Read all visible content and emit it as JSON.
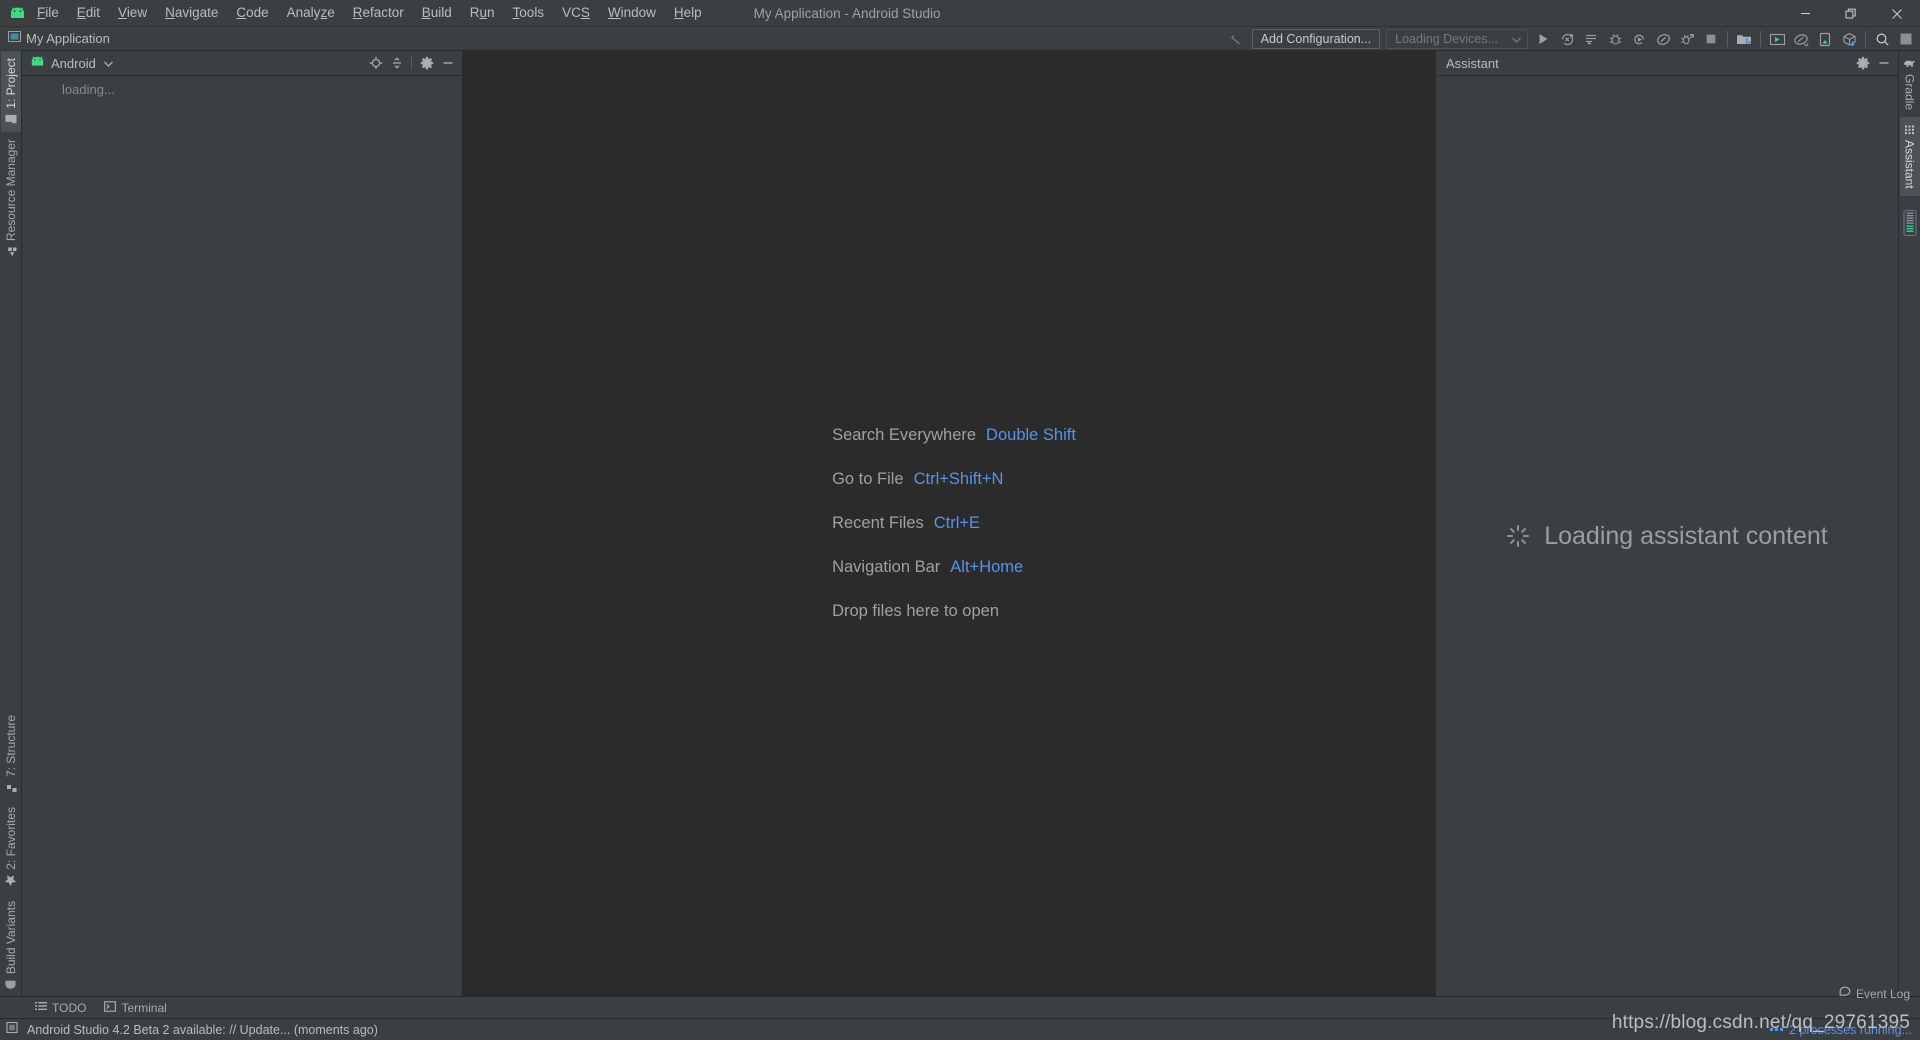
{
  "window": {
    "title": "My Application - Android Studio",
    "minimize_label": "Minimize",
    "restore_label": "Restore",
    "close_label": "Close"
  },
  "menubar": {
    "items": [
      {
        "label": "File",
        "mnemonic": "F"
      },
      {
        "label": "Edit",
        "mnemonic": "E"
      },
      {
        "label": "View",
        "mnemonic": "V"
      },
      {
        "label": "Navigate",
        "mnemonic": "N"
      },
      {
        "label": "Code",
        "mnemonic": "C"
      },
      {
        "label": "Analyze",
        "mnemonic": "z"
      },
      {
        "label": "Refactor",
        "mnemonic": "R"
      },
      {
        "label": "Build",
        "mnemonic": "B"
      },
      {
        "label": "Run",
        "mnemonic": "u"
      },
      {
        "label": "Tools",
        "mnemonic": "T"
      },
      {
        "label": "VCS",
        "mnemonic": "S"
      },
      {
        "label": "Window",
        "mnemonic": "W"
      },
      {
        "label": "Help",
        "mnemonic": "H"
      }
    ]
  },
  "navbar": {
    "breadcrumb": "My Application",
    "breadcrumb_icon": "module-icon",
    "back_icon": "back-arrow-icon",
    "add_configuration_label": "Add Configuration...",
    "device_selector_value": "Loading Devices...",
    "toolbar_icons": [
      {
        "name": "run-icon",
        "title": "Run"
      },
      {
        "name": "apply-changes-icon",
        "title": "Apply Changes"
      },
      {
        "name": "apply-code-changes-icon",
        "title": "Apply Code Changes"
      },
      {
        "name": "debug-icon",
        "title": "Debug"
      },
      {
        "name": "run-with-coverage-icon",
        "title": "Run with Coverage"
      },
      {
        "name": "profiler-icon",
        "title": "Profile"
      },
      {
        "name": "attach-debugger-icon",
        "title": "Attach Debugger to Process"
      },
      {
        "name": "stop-icon",
        "title": "Stop"
      },
      {
        "name": "sdk-manager-icon",
        "title": "SDK Manager"
      },
      {
        "name": "avd-manager-icon",
        "title": "AVD Manager"
      },
      {
        "name": "gradle-sync-icon",
        "title": "Sync Project with Gradle Files"
      },
      {
        "name": "device-file-explorer-icon",
        "title": "Device File Explorer"
      },
      {
        "name": "layout-inspector-icon",
        "title": "Layout Inspector"
      },
      {
        "name": "search-everywhere-icon",
        "title": "Search Everywhere"
      },
      {
        "name": "project-structure-icon",
        "title": "Project Structure"
      }
    ]
  },
  "left_strip": {
    "top_tabs": [
      {
        "label": "1: Project",
        "mnemonic": "1",
        "icon": "folder-icon",
        "active": true
      },
      {
        "label": "Resource Manager",
        "icon": "resource-manager-icon",
        "active": false
      }
    ],
    "bottom_tabs": [
      {
        "label": "7: Structure",
        "mnemonic": "7",
        "icon": "structure-icon",
        "active": false
      },
      {
        "label": "2: Favorites",
        "mnemonic": "2",
        "icon": "star-icon",
        "active": false
      },
      {
        "label": "Build Variants",
        "icon": "android-icon",
        "active": false
      }
    ]
  },
  "project_panel": {
    "icon": "android-head-icon",
    "view_label": "Android",
    "dropdown_icon": "chevron-down-icon",
    "actions": [
      {
        "name": "scroll-from-source-icon",
        "title": "Select Opened File"
      },
      {
        "name": "collapse-all-icon",
        "title": "Collapse All"
      },
      {
        "name": "settings-gear-icon",
        "title": "Options"
      },
      {
        "name": "hide-panel-icon",
        "title": "Hide"
      }
    ],
    "content_text": "loading..."
  },
  "editor": {
    "hints": [
      {
        "label": "Search Everywhere",
        "shortcut": "Double Shift"
      },
      {
        "label": "Go to File",
        "shortcut": "Ctrl+Shift+N"
      },
      {
        "label": "Recent Files",
        "shortcut": "Ctrl+E"
      },
      {
        "label": "Navigation Bar",
        "shortcut": "Alt+Home"
      },
      {
        "label": "Drop files here to open",
        "shortcut": ""
      }
    ]
  },
  "assistant_panel": {
    "title": "Assistant",
    "actions": [
      {
        "name": "settings-gear-icon",
        "title": "Settings"
      },
      {
        "name": "hide-panel-icon",
        "title": "Hide"
      }
    ],
    "loading_text": "Loading assistant content",
    "loading_icon": "spinner-icon"
  },
  "right_strip": {
    "tabs": [
      {
        "label": "Gradle",
        "icon": "gradle-elephant-icon",
        "active": false
      },
      {
        "label": "Assistant",
        "icon": "assistant-grid-icon",
        "active": true
      },
      {
        "label": "",
        "icon": "emulator-icon",
        "active": false
      }
    ]
  },
  "bottom_strip": {
    "tabs": [
      {
        "label": "TODO",
        "icon": "todo-list-icon"
      },
      {
        "label": "Terminal",
        "icon": "terminal-icon"
      }
    ]
  },
  "statusbar": {
    "icon": "notification-icon",
    "message": "Android Studio 4.2 Beta 2 available: // Update... (moments ago)",
    "event_log_label": "Event Log",
    "event_log_icon": "event-log-icon",
    "processes_text": "2 processes running..."
  },
  "watermark": {
    "text": "https://blog.csdn.net/qq_29761395"
  },
  "colors": {
    "chrome_bg": "#3c3f41",
    "editor_bg": "#2b2b2b",
    "border": "#2b2b2b",
    "text_primary": "#bbbbbb",
    "text_muted": "#8a8a8a",
    "accent_blue": "#5394ec",
    "android_green": "#3ddc84",
    "selection": "#4e5254"
  }
}
